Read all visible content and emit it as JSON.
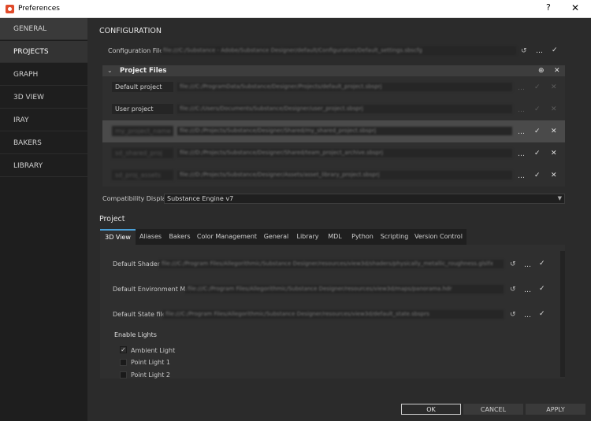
{
  "window": {
    "title": "Preferences",
    "help": "?",
    "close": "✕"
  },
  "sidebar": {
    "items": [
      "GENERAL",
      "PROJECTS",
      "GRAPH",
      "3D VIEW",
      "IRAY",
      "BAKERS",
      "LIBRARY"
    ],
    "active": "PROJECTS"
  },
  "configuration": {
    "heading": "CONFIGURATION",
    "file_label": "Configuration File:",
    "file_path": "file:///C:/Substance - Adobe/Substance Designer/default/Configuration/Default_settings.sbscfg"
  },
  "project_files": {
    "title": "Project Files",
    "rows": [
      {
        "name": "Default project",
        "path": "file:///C:/ProgramData/Substance/Designer/Projects/default_project.sbsprj"
      },
      {
        "name": "User project",
        "path": "file:///C:/Users/Documents/Substance/Designer/user_project.sbsprj"
      },
      {
        "name": "my_project_name",
        "path": "file:///D:/Projects/Substance/Designer/Shared/my_shared_project.sbsprj"
      },
      {
        "name": "sd_shared_proj",
        "path": "file:///D:/Projects/Substance/Designer/Shared/team_project_archive.sbsprj"
      },
      {
        "name": "sd_proj_assets",
        "path": "file:///D:/Projects/Substance/Designer/Assets/asset_library_project.sbsprj"
      }
    ]
  },
  "compat": {
    "label": "Compatibility Display:",
    "value": "Substance Engine v7"
  },
  "project": {
    "heading": "Project",
    "tabs": [
      "3D View",
      "Aliases",
      "Bakers",
      "Color Management",
      "General",
      "Library",
      "MDL",
      "Python",
      "Scripting",
      "Version Control"
    ],
    "active_tab": "3D View",
    "fields": [
      {
        "label": "Default Shader:",
        "path": "file:///C:/Program Files/Allegorithmic/Substance Designer/resources/view3d/shaders/physically_metallic_roughness.glslfx"
      },
      {
        "label": "Default Environment Map:",
        "path": "file:///C:/Program Files/Allegorithmic/Substance Designer/resources/view3d/maps/panorama.hdr"
      },
      {
        "label": "Default State file:",
        "path": "file:///C:/Program Files/Allegorithmic/Substance Designer/resources/view3d/default_state.sbsprs"
      }
    ],
    "lights_heading": "Enable Lights",
    "lights": [
      {
        "label": "Ambient Light",
        "checked": true
      },
      {
        "label": "Point Light 1",
        "checked": false
      },
      {
        "label": "Point Light 2",
        "checked": false
      }
    ]
  },
  "buttons": {
    "ok": "OK",
    "cancel": "CANCEL",
    "apply": "APPLY"
  },
  "colors": {
    "accent": "#4aa0d8",
    "app_icon": "#e04a2a"
  }
}
